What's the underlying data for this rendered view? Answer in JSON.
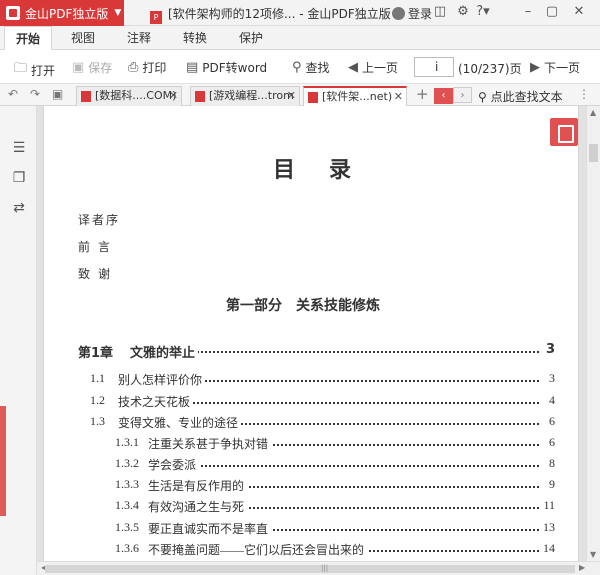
{
  "app": {
    "name": "金山PDF独立版",
    "window_title": "[软件架构师的12项修... - 金山PDF独立版",
    "login": "登录",
    "brand_color": "#d93838"
  },
  "menu_tabs": [
    "开始",
    "视图",
    "注释",
    "转换",
    "保护"
  ],
  "toolbar": {
    "open": "打开",
    "save": "保存",
    "print": "打印",
    "pdf_to_word": "PDF转word",
    "find": "查找",
    "prev_page": "上一页",
    "page_input": "i",
    "page_count": "(10/237)页",
    "next_page": "下一页"
  },
  "doc_tabs": [
    {
      "label": "[数据科....COM)",
      "active": false
    },
    {
      "label": "[游戏编程...trom",
      "active": false
    },
    {
      "label": "[软件架...net)",
      "active": true
    }
  ],
  "find_text_label": "点此查找文本",
  "document": {
    "toc_title": "目录",
    "front_matter": [
      "译者序",
      "前言",
      "致谢"
    ],
    "part_heading": "第一部分　关系技能修炼",
    "entries": [
      {
        "num": "第1章",
        "title": "文雅的举止",
        "page": "3",
        "level": 0
      },
      {
        "num": "1.1",
        "title": "别人怎样评价你",
        "page": "3",
        "level": 1
      },
      {
        "num": "1.2",
        "title": "技术之天花板",
        "page": "4",
        "level": 1
      },
      {
        "num": "1.3",
        "title": "变得文雅、专业的途径",
        "page": "6",
        "level": 1
      },
      {
        "num": "1.3.1",
        "title": "注重关系甚于争执对错",
        "page": "6",
        "level": 2
      },
      {
        "num": "1.3.2",
        "title": "学会委派",
        "page": "8",
        "level": 2
      },
      {
        "num": "1.3.3",
        "title": "生活是有反作用的",
        "page": "9",
        "level": 2
      },
      {
        "num": "1.3.4",
        "title": "有效沟通之生与死",
        "page": "11",
        "level": 2
      },
      {
        "num": "1.3.5",
        "title": "要正直诚实而不是率直",
        "page": "13",
        "level": 2
      },
      {
        "num": "1.3.6",
        "title": "不要掩盖问题——它们以后还会冒出来的",
        "page": "14",
        "level": 2
      }
    ]
  }
}
